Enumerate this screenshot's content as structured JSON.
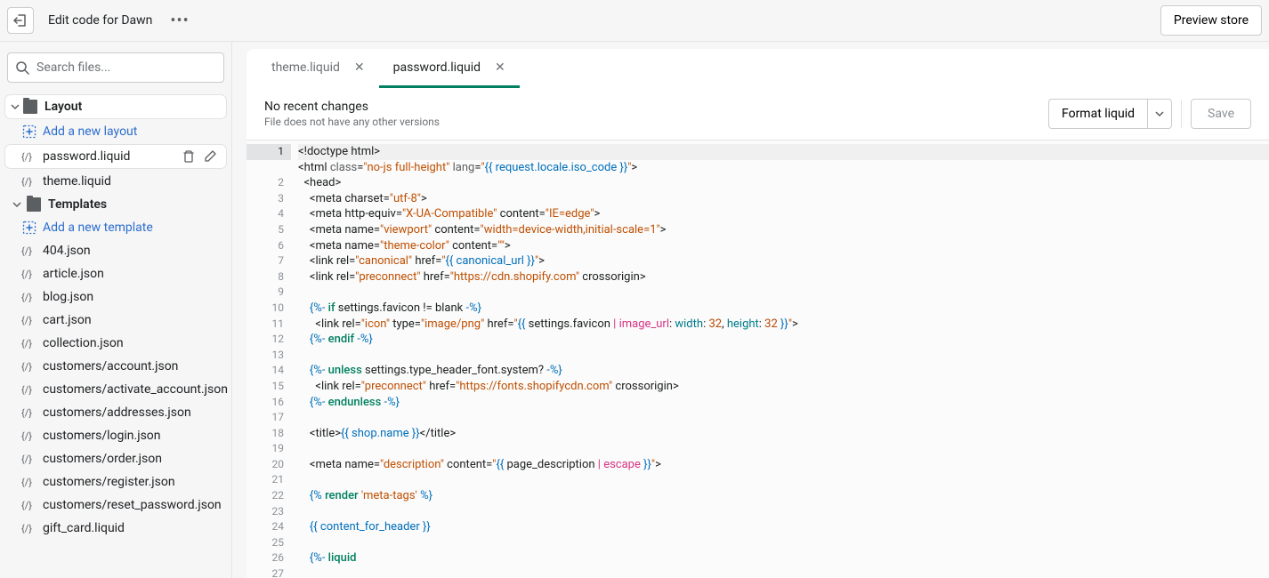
{
  "topbar": {
    "title": "Edit code for Dawn",
    "preview_label": "Preview store"
  },
  "search": {
    "placeholder": "Search files..."
  },
  "tree": {
    "folder_layout": "Layout",
    "add_layout": "Add a new layout",
    "file_password": "password.liquid",
    "file_theme": "theme.liquid",
    "folder_templates": "Templates",
    "add_template": "Add a new template",
    "templates": [
      "404.json",
      "article.json",
      "blog.json",
      "cart.json",
      "collection.json",
      "customers/account.json",
      "customers/activate_account.json",
      "customers/addresses.json",
      "customers/login.json",
      "customers/order.json",
      "customers/register.json",
      "customers/reset_password.json",
      "gift_card.liquid"
    ]
  },
  "tabs": {
    "t1": "theme.liquid",
    "t2": "password.liquid"
  },
  "filebar": {
    "title": "No recent changes",
    "sub": "File does not have any other versions",
    "format": "Format liquid",
    "save": "Save"
  },
  "code_lines": 27
}
